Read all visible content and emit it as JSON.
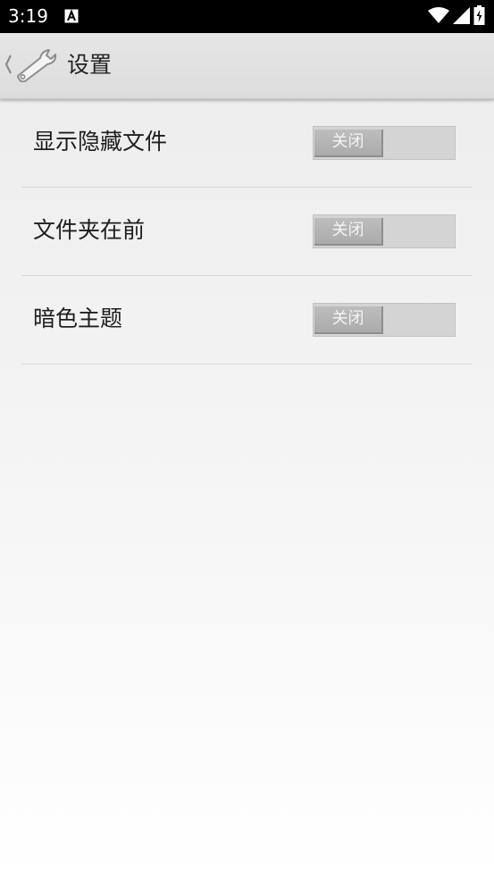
{
  "status_bar": {
    "time": "3:19",
    "icons": [
      "notification-a-icon",
      "wifi-icon",
      "cell-signal-icon",
      "battery-charging-icon"
    ]
  },
  "app_bar": {
    "title": "设置",
    "icon": "wrench-icon"
  },
  "settings": [
    {
      "label": "显示隐藏文件",
      "toggle_text": "关闭",
      "state": "off"
    },
    {
      "label": "文件夹在前",
      "toggle_text": "关闭",
      "state": "off"
    },
    {
      "label": "暗色主题",
      "toggle_text": "关闭",
      "state": "off"
    }
  ],
  "colors": {
    "status_bar": "#000000",
    "app_bar": "#e0e0e0",
    "toggle_track": "#d4d4d4",
    "toggle_thumb": "#b4b4b4",
    "divider": "#d6d6d6"
  }
}
